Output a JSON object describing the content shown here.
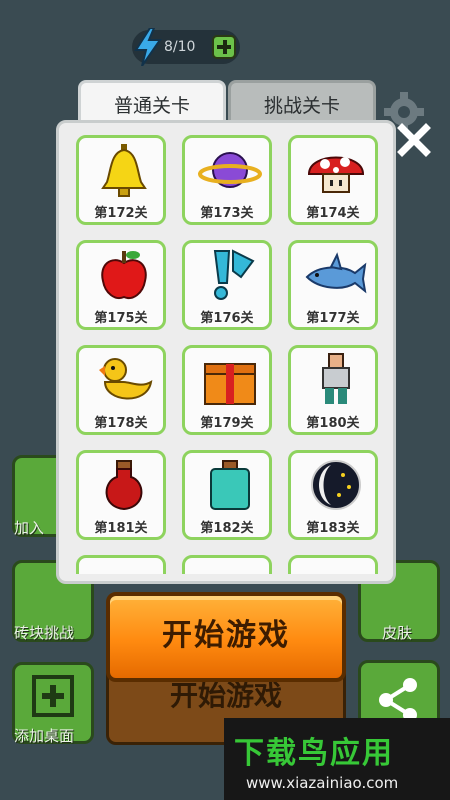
{
  "energy": {
    "value": "8/10",
    "icon": "lightning-icon"
  },
  "tabs": [
    {
      "label": "普通关卡",
      "active": true
    },
    {
      "label": "挑战关卡",
      "active": false
    }
  ],
  "levels": [
    {
      "label": "第172关",
      "icon": "bell-icon"
    },
    {
      "label": "第173关",
      "icon": "planet-icon"
    },
    {
      "label": "第174关",
      "icon": "mushroom-icon"
    },
    {
      "label": "第175关",
      "icon": "apple-icon"
    },
    {
      "label": "第176关",
      "icon": "exclamation-icon"
    },
    {
      "label": "第177关",
      "icon": "shark-icon"
    },
    {
      "label": "第178关",
      "icon": "duck-icon"
    },
    {
      "label": "第179关",
      "icon": "gift-icon"
    },
    {
      "label": "第180关",
      "icon": "person-icon"
    },
    {
      "label": "第181关",
      "icon": "red-potion-icon"
    },
    {
      "label": "第182关",
      "icon": "teal-potion-icon"
    },
    {
      "label": "第183关",
      "icon": "moon-icon"
    }
  ],
  "side_buttons": {
    "join": "加入",
    "brick_challenge": "砖块挑战",
    "add_desktop": "添加桌面",
    "skin": "皮肤"
  },
  "start_button": "开始游戏",
  "background_start_button": "开始游戏",
  "watermark": {
    "title": "下载鸟应用",
    "url": "www.xiazainiao.com"
  },
  "colors": {
    "card_border": "#8ed35e",
    "start_button": "#ff9a1f",
    "panel": "#ededed"
  }
}
